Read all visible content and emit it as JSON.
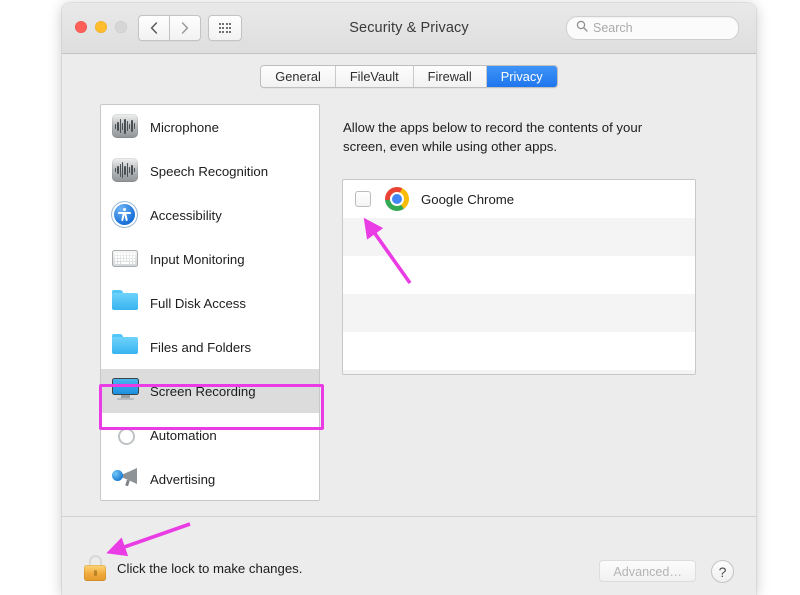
{
  "window": {
    "title": "Security & Privacy",
    "traffic_lights": [
      "close",
      "minimize",
      "zoom"
    ],
    "nav": {
      "back_icon": "chevron-left-icon",
      "forward_icon": "chevron-right-icon",
      "grid_icon": "grid-dots-icon"
    }
  },
  "search": {
    "placeholder": "Search",
    "icon": "search-icon"
  },
  "tabs": [
    {
      "label": "General",
      "active": false
    },
    {
      "label": "FileVault",
      "active": false
    },
    {
      "label": "Firewall",
      "active": false
    },
    {
      "label": "Privacy",
      "active": true
    }
  ],
  "sidebar": {
    "items": [
      {
        "label": "Microphone",
        "icon": "microphone-icon",
        "selected": false
      },
      {
        "label": "Speech Recognition",
        "icon": "speech-recognition-icon",
        "selected": false
      },
      {
        "label": "Accessibility",
        "icon": "accessibility-icon",
        "selected": false
      },
      {
        "label": "Input Monitoring",
        "icon": "keyboard-icon",
        "selected": false
      },
      {
        "label": "Full Disk Access",
        "icon": "folder-icon",
        "selected": false
      },
      {
        "label": "Files and Folders",
        "icon": "folder-icon",
        "selected": false
      },
      {
        "label": "Screen Recording",
        "icon": "display-icon",
        "selected": true
      },
      {
        "label": "Automation",
        "icon": "gear-icon",
        "selected": false
      },
      {
        "label": "Advertising",
        "icon": "megaphone-icon",
        "selected": false
      }
    ]
  },
  "main": {
    "description": "Allow the apps below to record the contents of your screen, even while using other apps.",
    "apps": [
      {
        "name": "Google Chrome",
        "icon": "chrome-icon",
        "checked": false
      }
    ]
  },
  "bottom": {
    "lock_icon": "lock-closed-icon",
    "lock_text": "Click the lock to make changes.",
    "advanced_label": "Advanced…",
    "help_label": "?"
  },
  "annotations": {
    "highlight_color": "#ea3ce4",
    "items": [
      {
        "name": "arrow-to-checkbox",
        "target": "Google Chrome checkbox"
      },
      {
        "name": "arrow-to-lock",
        "target": "lock icon"
      },
      {
        "name": "box-around-screen-recording",
        "target": "Screen Recording sidebar item"
      }
    ]
  },
  "colors": {
    "accent": "#1f76ee",
    "window_bg": "#ececec",
    "annotation": "#ea3ce4"
  }
}
